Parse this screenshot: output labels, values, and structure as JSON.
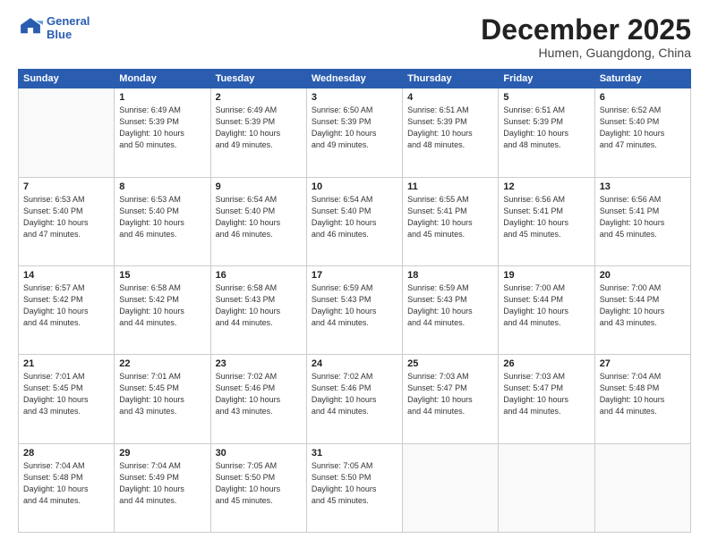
{
  "logo": {
    "line1": "General",
    "line2": "Blue"
  },
  "title": "December 2025",
  "subtitle": "Humen, Guangdong, China",
  "header_days": [
    "Sunday",
    "Monday",
    "Tuesday",
    "Wednesday",
    "Thursday",
    "Friday",
    "Saturday"
  ],
  "weeks": [
    [
      {
        "day": "",
        "detail": ""
      },
      {
        "day": "1",
        "detail": "Sunrise: 6:49 AM\nSunset: 5:39 PM\nDaylight: 10 hours\nand 50 minutes."
      },
      {
        "day": "2",
        "detail": "Sunrise: 6:49 AM\nSunset: 5:39 PM\nDaylight: 10 hours\nand 49 minutes."
      },
      {
        "day": "3",
        "detail": "Sunrise: 6:50 AM\nSunset: 5:39 PM\nDaylight: 10 hours\nand 49 minutes."
      },
      {
        "day": "4",
        "detail": "Sunrise: 6:51 AM\nSunset: 5:39 PM\nDaylight: 10 hours\nand 48 minutes."
      },
      {
        "day": "5",
        "detail": "Sunrise: 6:51 AM\nSunset: 5:39 PM\nDaylight: 10 hours\nand 48 minutes."
      },
      {
        "day": "6",
        "detail": "Sunrise: 6:52 AM\nSunset: 5:40 PM\nDaylight: 10 hours\nand 47 minutes."
      }
    ],
    [
      {
        "day": "7",
        "detail": "Sunrise: 6:53 AM\nSunset: 5:40 PM\nDaylight: 10 hours\nand 47 minutes."
      },
      {
        "day": "8",
        "detail": "Sunrise: 6:53 AM\nSunset: 5:40 PM\nDaylight: 10 hours\nand 46 minutes."
      },
      {
        "day": "9",
        "detail": "Sunrise: 6:54 AM\nSunset: 5:40 PM\nDaylight: 10 hours\nand 46 minutes."
      },
      {
        "day": "10",
        "detail": "Sunrise: 6:54 AM\nSunset: 5:40 PM\nDaylight: 10 hours\nand 46 minutes."
      },
      {
        "day": "11",
        "detail": "Sunrise: 6:55 AM\nSunset: 5:41 PM\nDaylight: 10 hours\nand 45 minutes."
      },
      {
        "day": "12",
        "detail": "Sunrise: 6:56 AM\nSunset: 5:41 PM\nDaylight: 10 hours\nand 45 minutes."
      },
      {
        "day": "13",
        "detail": "Sunrise: 6:56 AM\nSunset: 5:41 PM\nDaylight: 10 hours\nand 45 minutes."
      }
    ],
    [
      {
        "day": "14",
        "detail": "Sunrise: 6:57 AM\nSunset: 5:42 PM\nDaylight: 10 hours\nand 44 minutes."
      },
      {
        "day": "15",
        "detail": "Sunrise: 6:58 AM\nSunset: 5:42 PM\nDaylight: 10 hours\nand 44 minutes."
      },
      {
        "day": "16",
        "detail": "Sunrise: 6:58 AM\nSunset: 5:43 PM\nDaylight: 10 hours\nand 44 minutes."
      },
      {
        "day": "17",
        "detail": "Sunrise: 6:59 AM\nSunset: 5:43 PM\nDaylight: 10 hours\nand 44 minutes."
      },
      {
        "day": "18",
        "detail": "Sunrise: 6:59 AM\nSunset: 5:43 PM\nDaylight: 10 hours\nand 44 minutes."
      },
      {
        "day": "19",
        "detail": "Sunrise: 7:00 AM\nSunset: 5:44 PM\nDaylight: 10 hours\nand 44 minutes."
      },
      {
        "day": "20",
        "detail": "Sunrise: 7:00 AM\nSunset: 5:44 PM\nDaylight: 10 hours\nand 43 minutes."
      }
    ],
    [
      {
        "day": "21",
        "detail": "Sunrise: 7:01 AM\nSunset: 5:45 PM\nDaylight: 10 hours\nand 43 minutes."
      },
      {
        "day": "22",
        "detail": "Sunrise: 7:01 AM\nSunset: 5:45 PM\nDaylight: 10 hours\nand 43 minutes."
      },
      {
        "day": "23",
        "detail": "Sunrise: 7:02 AM\nSunset: 5:46 PM\nDaylight: 10 hours\nand 43 minutes."
      },
      {
        "day": "24",
        "detail": "Sunrise: 7:02 AM\nSunset: 5:46 PM\nDaylight: 10 hours\nand 44 minutes."
      },
      {
        "day": "25",
        "detail": "Sunrise: 7:03 AM\nSunset: 5:47 PM\nDaylight: 10 hours\nand 44 minutes."
      },
      {
        "day": "26",
        "detail": "Sunrise: 7:03 AM\nSunset: 5:47 PM\nDaylight: 10 hours\nand 44 minutes."
      },
      {
        "day": "27",
        "detail": "Sunrise: 7:04 AM\nSunset: 5:48 PM\nDaylight: 10 hours\nand 44 minutes."
      }
    ],
    [
      {
        "day": "28",
        "detail": "Sunrise: 7:04 AM\nSunset: 5:48 PM\nDaylight: 10 hours\nand 44 minutes."
      },
      {
        "day": "29",
        "detail": "Sunrise: 7:04 AM\nSunset: 5:49 PM\nDaylight: 10 hours\nand 44 minutes."
      },
      {
        "day": "30",
        "detail": "Sunrise: 7:05 AM\nSunset: 5:50 PM\nDaylight: 10 hours\nand 45 minutes."
      },
      {
        "day": "31",
        "detail": "Sunrise: 7:05 AM\nSunset: 5:50 PM\nDaylight: 10 hours\nand 45 minutes."
      },
      {
        "day": "",
        "detail": ""
      },
      {
        "day": "",
        "detail": ""
      },
      {
        "day": "",
        "detail": ""
      }
    ]
  ]
}
